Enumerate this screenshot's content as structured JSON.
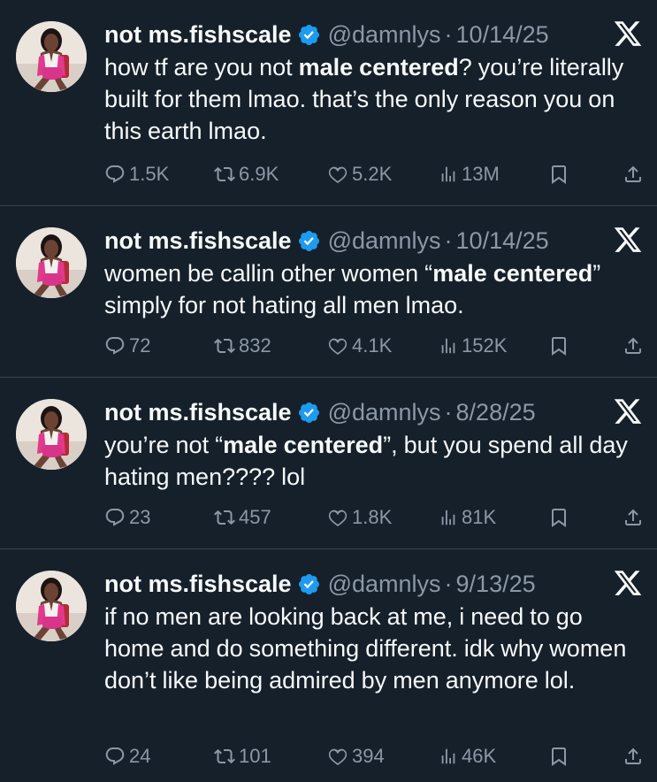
{
  "tweets": [
    {
      "name": "not ms.fishscale",
      "handle": "@damnlys",
      "separator": "·",
      "date": "10/14/25",
      "text_parts": [
        {
          "t": "how tf are you not ",
          "b": false
        },
        {
          "t": "male centered",
          "b": true
        },
        {
          "t": "? you’re literally built for them lmao. that’s the only reason you on this earth lmao.",
          "b": false
        }
      ],
      "replies": "1.5K",
      "reposts": "6.9K",
      "likes": "5.2K",
      "views": "13M"
    },
    {
      "name": "not ms.fishscale",
      "handle": "@damnlys",
      "separator": "·",
      "date": "10/14/25",
      "text_parts": [
        {
          "t": "women be callin other women “",
          "b": false
        },
        {
          "t": "male centered",
          "b": true
        },
        {
          "t": "” simply for not hating all men lmao.",
          "b": false
        }
      ],
      "replies": "72",
      "reposts": "832",
      "likes": "4.1K",
      "views": "152K"
    },
    {
      "name": "not ms.fishscale",
      "handle": "@damnlys",
      "separator": "·",
      "date": "8/28/25",
      "text_parts": [
        {
          "t": "you’re not “",
          "b": false
        },
        {
          "t": "male centered",
          "b": true
        },
        {
          "t": "”, but you spend all day hating men???? lol",
          "b": false
        }
      ],
      "replies": "23",
      "reposts": "457",
      "likes": "1.8K",
      "views": "81K"
    },
    {
      "name": "not ms.fishscale",
      "handle": "@damnlys",
      "separator": "·",
      "date": "9/13/25",
      "text_parts": [
        {
          "t": "if no men are looking back at me, i need to go home and do something different. idk why women don’t like being admired by men anymore lol.",
          "b": false
        }
      ],
      "replies": "24",
      "reposts": "101",
      "likes": "394",
      "views": "46K"
    }
  ],
  "colors": {
    "background": "#15202b",
    "text": "#f7f9f9",
    "muted": "#8b98a5",
    "divider": "#38444d",
    "verified": "#1d9bf0"
  },
  "icons": [
    "verified-badge-icon",
    "x-logo-icon",
    "reply-icon",
    "repost-icon",
    "like-icon",
    "views-icon",
    "bookmark-icon",
    "share-icon"
  ]
}
